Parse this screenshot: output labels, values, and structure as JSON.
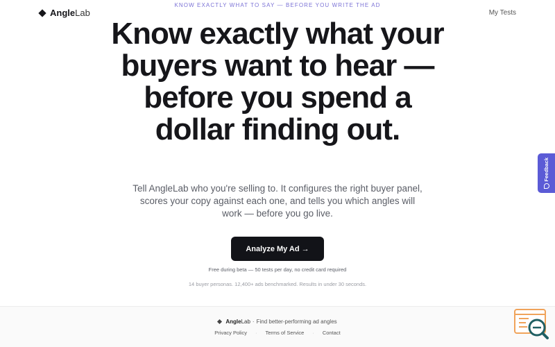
{
  "nav": {
    "brand_bold": "Angle",
    "brand_rest": "Lab",
    "tagline": "KNOW EXACTLY WHAT TO SAY — BEFORE YOU WRITE THE AD",
    "my_tests": "My Tests"
  },
  "hero": {
    "headline": "Know exactly what your buyers want to hear — before you spend a dollar finding out.",
    "subtext": "Tell AngleLab who you're selling to. It configures the right buyer panel, scores your copy against each one, and tells you which angles will work — before you go live.",
    "cta_label": "Analyze My Ad →",
    "note": "Free during beta — 50 tests per day, no credit card required",
    "stats": "14 buyer personas. 12,400+ ads benchmarked. Results in under 30 seconds."
  },
  "footer": {
    "brand_bold": "Angle",
    "brand_rest": "Lab",
    "brand_sep": "·",
    "tagline": "Find better-performing ad angles",
    "links": [
      "Privacy Policy",
      "Terms of Service",
      "Contact"
    ],
    "link_sep": "·"
  },
  "feedback": {
    "label": "Feedback"
  },
  "colors": {
    "accent": "#5b5bd6",
    "tagline": "#7c73d6",
    "cta_bg": "#121318",
    "widget_orange": "#f0a35a",
    "widget_teal": "#1f5f63"
  }
}
